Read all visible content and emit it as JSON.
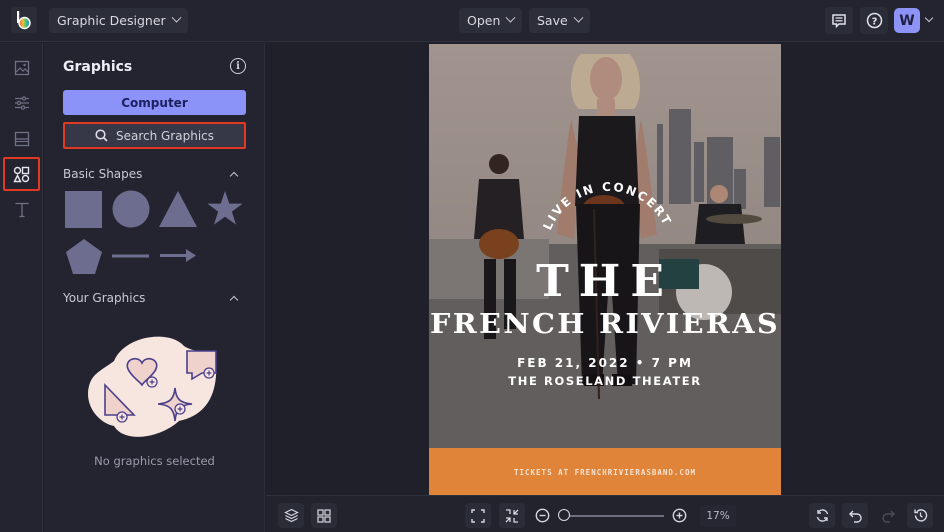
{
  "topbar": {
    "app_mode": "Graphic Designer",
    "open_label": "Open",
    "save_label": "Save",
    "avatar_initial": "W"
  },
  "rail": {
    "items": [
      {
        "name": "photos",
        "icon": "image-icon"
      },
      {
        "name": "edit",
        "icon": "sliders-icon"
      },
      {
        "name": "layouts",
        "icon": "layout-icon"
      },
      {
        "name": "graphics",
        "icon": "shapes-icon",
        "active": true
      },
      {
        "name": "text",
        "icon": "text-icon"
      }
    ]
  },
  "panel": {
    "title": "Graphics",
    "computer_label": "Computer",
    "search_label": "Search Graphics",
    "basic_shapes_heading": "Basic Shapes",
    "shapes": [
      "square",
      "circle",
      "triangle",
      "star",
      "pentagon",
      "line",
      "arrow"
    ],
    "your_graphics_heading": "Your Graphics",
    "empty_text": "No graphics selected"
  },
  "poster": {
    "arc_text": "LIVE IN CONCERT",
    "title_line1": "THE",
    "title_line2": "FRENCH RIVIERAS",
    "date_line": "FEB 21, 2022 • 7 PM",
    "venue_line": "THE ROSELAND THEATER",
    "footer_text": "TICKETS AT FRENCHRIVIERASBAND.COM",
    "footer_color": "#e0843a"
  },
  "bottombar": {
    "zoom_value": "17%",
    "zoom_fraction": 0.02
  },
  "colors": {
    "accent": "#8b93f8",
    "highlight": "#e03a22",
    "shape_fill": "#6c6d8f"
  }
}
